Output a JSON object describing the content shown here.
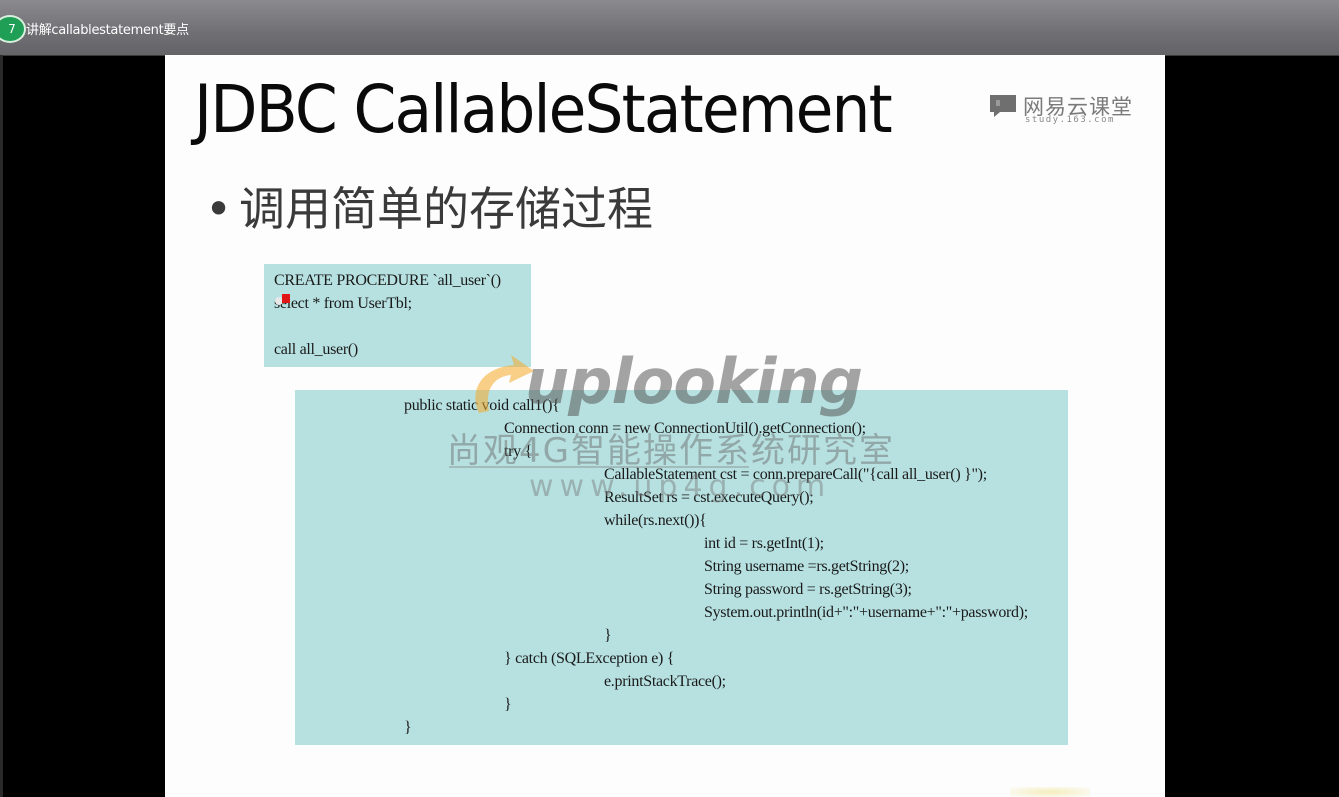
{
  "header": {
    "episode_number": "7",
    "video_title": "讲解callablestatement要点"
  },
  "slide": {
    "title": "JDBC CallableStatement",
    "brand": {
      "name": "网易云课堂",
      "url": "study.163.com"
    },
    "bullet": "调用简单的存储过程",
    "sql_code": [
      "CREATE PROCEDURE `all_user`()",
      "select * from UserTbl;",
      "",
      "call all_user()"
    ],
    "java_code": [
      {
        "indent": 0,
        "text": "public static void call1(){"
      },
      {
        "indent": 1,
        "text": "Connection conn = new ConnectionUtil().getConnection();"
      },
      {
        "indent": 1,
        "text": "try {"
      },
      {
        "indent": 2,
        "text": "CallableStatement cst = conn.prepareCall(\"{call all_user() }\");"
      },
      {
        "indent": 2,
        "text": "ResultSet rs = cst.executeQuery();"
      },
      {
        "indent": 2,
        "text": "while(rs.next()){"
      },
      {
        "indent": 3,
        "text": "int id = rs.getInt(1);"
      },
      {
        "indent": 3,
        "text": "String username =rs.getString(2);"
      },
      {
        "indent": 3,
        "text": "String password = rs.getString(3);"
      },
      {
        "indent": 3,
        "text": "System.out.println(id+\":\"+username+\":\"+password);"
      },
      {
        "indent": 2,
        "text": "}"
      },
      {
        "indent": 1,
        "text": "} catch (SQLException e) {"
      },
      {
        "indent": 2,
        "text": "e.printStackTrace();"
      },
      {
        "indent": 1,
        "text": "}"
      },
      {
        "indent": 0,
        "text": "}"
      }
    ],
    "watermark": {
      "logo": "uplooking",
      "subtitle": "尚观4G智能操作系统研究室",
      "url": "www.up4g.com"
    }
  },
  "colors": {
    "code_background": "#b7e1e1",
    "badge_green": "#1f9e55",
    "red_marker": "#e01515"
  }
}
